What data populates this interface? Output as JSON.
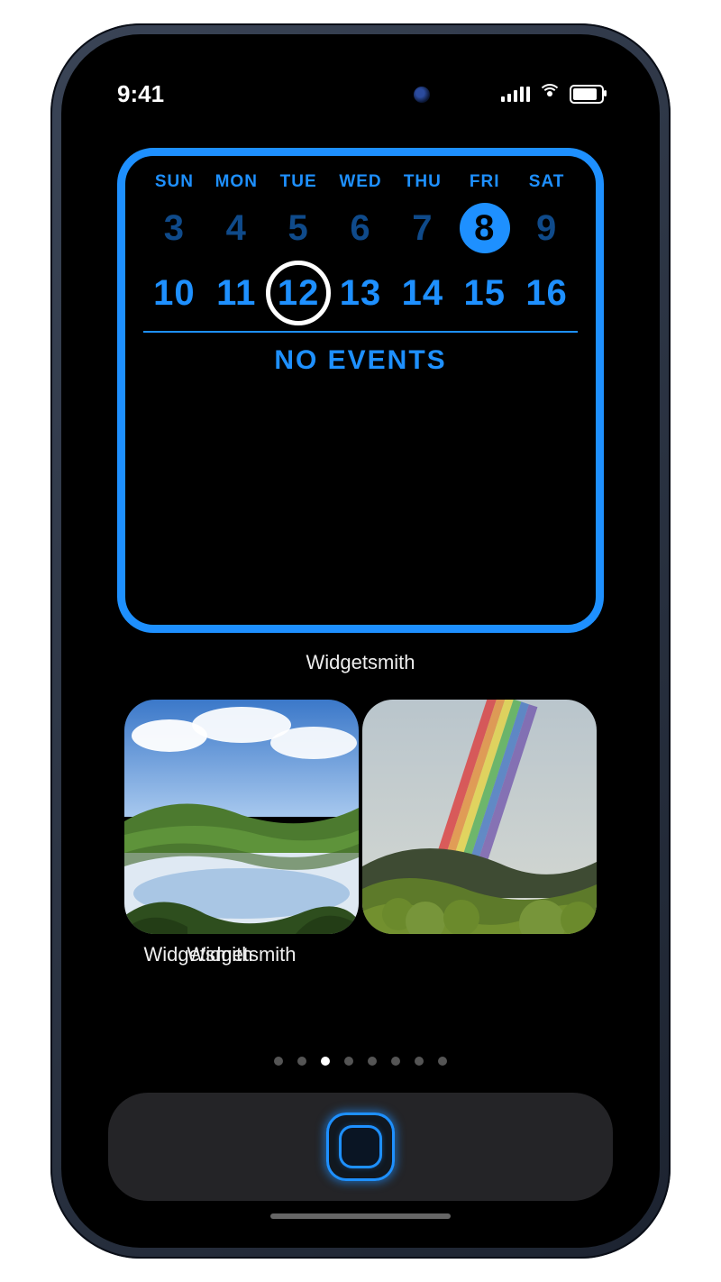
{
  "status": {
    "time": "9:41"
  },
  "calendar": {
    "days": [
      "SUN",
      "MON",
      "TUE",
      "WED",
      "THU",
      "FRI",
      "SAT"
    ],
    "row1": [
      "3",
      "4",
      "5",
      "6",
      "7",
      "8",
      "9"
    ],
    "row2": [
      "10",
      "11",
      "12",
      "13",
      "14",
      "15",
      "16"
    ],
    "highlight_day_index": 5,
    "today_row2_index": 2,
    "events_label": "NO EVENTS"
  },
  "labels": {
    "cal": "Widgetsmith",
    "photo_left": "Widgetsmith",
    "photo_right": "Widgetsmith"
  },
  "pages": {
    "count": 8,
    "active": 2
  },
  "colors": {
    "accent": "#1e90ff"
  }
}
